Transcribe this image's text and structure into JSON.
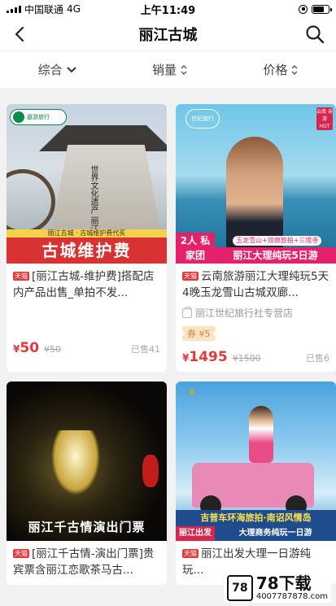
{
  "status_bar": {
    "carrier": "中国联通",
    "network": "4G",
    "time": "上午11:49"
  },
  "nav": {
    "title": "丽江古城"
  },
  "filters": [
    {
      "label": "综合"
    },
    {
      "label": "销量"
    },
    {
      "label": "价格"
    }
  ],
  "products": [
    {
      "tag": "天猫",
      "title": "[丽江古城-维护费]搭配店内产品出售_单拍不发...",
      "image_logo": "遨游旅行",
      "image_banner_top": "丽江古城 · 古城维护费代买",
      "image_banner_main": "古城维护费",
      "image_wall_text": "世界文化遗产 丽江古城",
      "currency": "¥",
      "price": "50",
      "old_price": "¥50",
      "sold": "已售41"
    },
    {
      "tag": "天猫",
      "title": "云南旅游丽江大理纯玩5天4晚玉龙雪山古城双廊...",
      "image_logo": "世纪旅行",
      "image_hot_badge": "云南 亲游 HOT",
      "image_tag": "2人 私家团",
      "image_sub": "玉龙雪山+双廊旅拍+三塔寺",
      "image_main": "丽江大理纯玩5日游",
      "shop": "丽江世纪旅行社专营店",
      "coupon": "券 ¥5",
      "currency": "¥",
      "price": "1495",
      "old_price": "¥1500",
      "sold": "已售6"
    },
    {
      "tag": "天猫",
      "title": "[丽江千古情-演出门票]贵宾票含丽江恋歌茶马古...",
      "image_main": "丽江千古情演出门票"
    },
    {
      "tag": "天猫",
      "title": "丽江出发大理一日游纯玩...",
      "image_banner": "吉普车环海旅拍·南诏风情岛",
      "image_tag": "丽江出发",
      "image_main": "大理商务纯玩一日游"
    }
  ],
  "watermark": {
    "brand": "78下载",
    "url": "40077878​78.com",
    "logo": "78"
  }
}
